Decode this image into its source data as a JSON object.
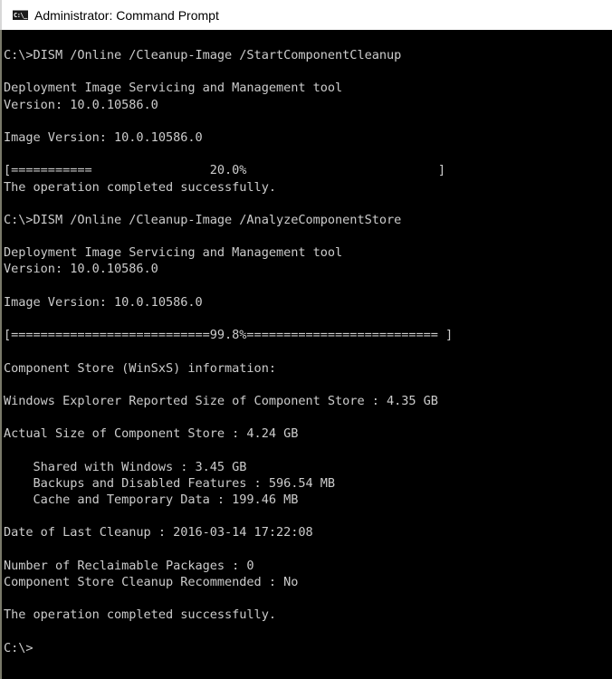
{
  "window": {
    "title": "Administrator: Command Prompt",
    "icon": "command-prompt-icon",
    "icon_label": "C:\\_"
  },
  "console": {
    "lines": [
      "C:\\>DISM /Online /Cleanup-Image /StartComponentCleanup",
      "",
      "Deployment Image Servicing and Management tool",
      "Version: 10.0.10586.0",
      "",
      "Image Version: 10.0.10586.0",
      "",
      "[===========                20.0%                          ]",
      "The operation completed successfully.",
      "",
      "C:\\>DISM /Online /Cleanup-Image /AnalyzeComponentStore",
      "",
      "Deployment Image Servicing and Management tool",
      "Version: 10.0.10586.0",
      "",
      "Image Version: 10.0.10586.0",
      "",
      "[===========================99.8%========================== ]",
      "",
      "Component Store (WinSxS) information:",
      "",
      "Windows Explorer Reported Size of Component Store : 4.35 GB",
      "",
      "Actual Size of Component Store : 4.24 GB",
      "",
      "    Shared with Windows : 3.45 GB",
      "    Backups and Disabled Features : 596.54 MB",
      "    Cache and Temporary Data : 199.46 MB",
      "",
      "Date of Last Cleanup : 2016-03-14 17:22:08",
      "",
      "Number of Reclaimable Packages : 0",
      "Component Store Cleanup Recommended : No",
      "",
      "The operation completed successfully.",
      "",
      "C:\\>"
    ],
    "progress": [
      {
        "operation": "StartComponentCleanup",
        "percent": 20.0
      },
      {
        "operation": "AnalyzeComponentStore",
        "percent": 99.8
      }
    ],
    "component_store": {
      "explorer_reported_size": "4.35 GB",
      "actual_size": "4.24 GB",
      "shared_with_windows": "3.45 GB",
      "backups_and_disabled_features": "596.54 MB",
      "cache_and_temporary_data": "199.46 MB",
      "date_of_last_cleanup": "2016-03-14 17:22:08",
      "reclaimable_packages": "0",
      "cleanup_recommended": "No"
    },
    "prompt": "C:\\>"
  },
  "colors": {
    "console_background": "#000000",
    "console_text": "#cccccc",
    "titlebar_background": "#ffffff"
  }
}
